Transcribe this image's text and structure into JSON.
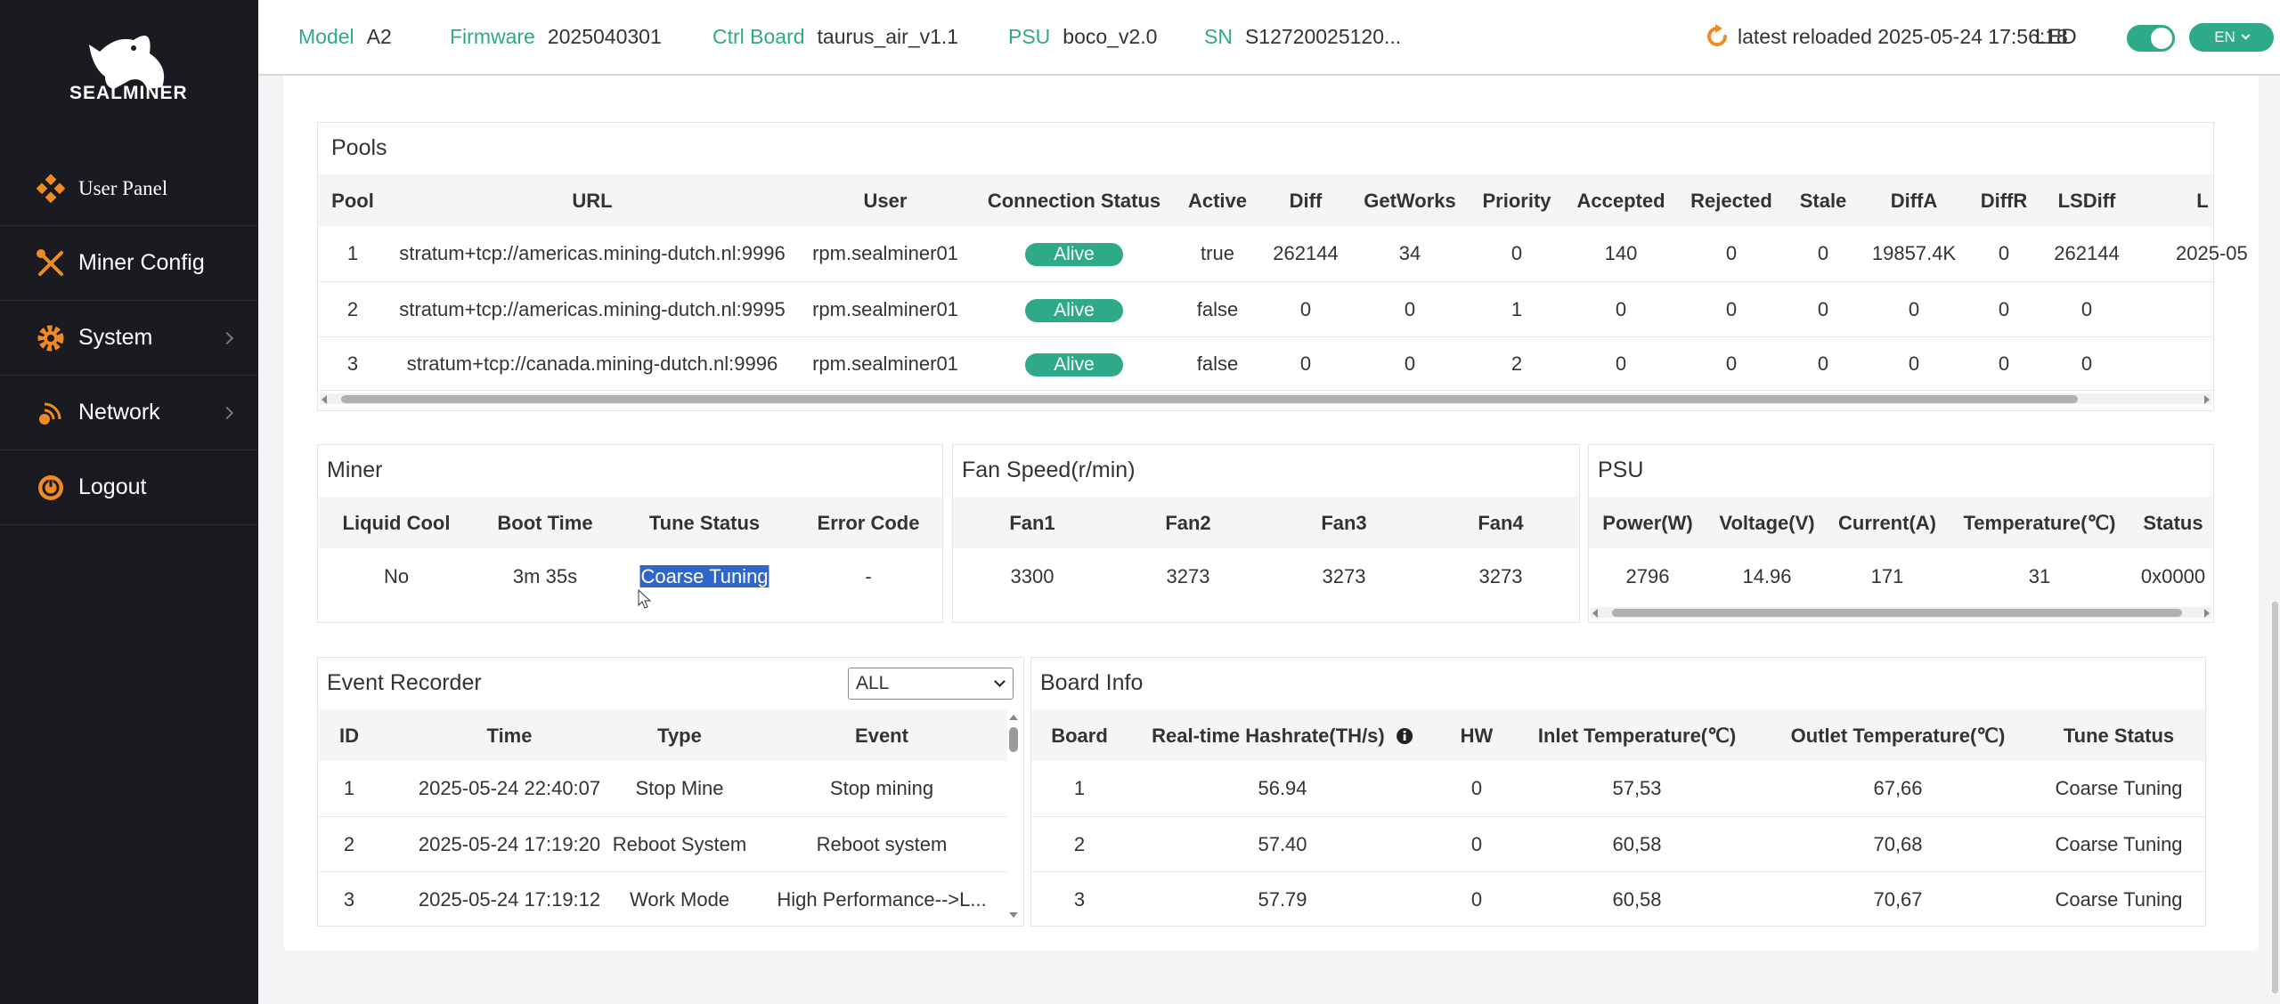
{
  "brand": {
    "name": "SEALMINER"
  },
  "sidebar": {
    "items": [
      {
        "label": "User Panel",
        "icon": "user-panel-icon"
      },
      {
        "label": "Miner Config",
        "icon": "tools-icon"
      },
      {
        "label": "System",
        "icon": "gear-icon"
      },
      {
        "label": "Network",
        "icon": "network-icon"
      },
      {
        "label": "Logout",
        "icon": "power-icon"
      }
    ]
  },
  "header": {
    "model_label": "Model",
    "model": "A2",
    "firmware_label": "Firmware",
    "firmware": "2025040301",
    "ctrl_label": "Ctrl Board",
    "ctrl": "taurus_air_v1.1",
    "psu_label": "PSU",
    "psu": "boco_v2.0",
    "sn_label": "SN",
    "sn": "S12720025120...",
    "reload": "latest reloaded 2025-05-24 17:56:18",
    "led_label": "LED",
    "lang": "EN",
    "accent": "#2eaa88"
  },
  "pools": {
    "title": "Pools",
    "columns": [
      "Pool",
      "URL",
      "User",
      "Connection Status",
      "Active",
      "Diff",
      "GetWorks",
      "Priority",
      "Accepted",
      "Rejected",
      "Stale",
      "DiffA",
      "DiffR",
      "LSDiff",
      "L"
    ],
    "rows": [
      [
        "1",
        "stratum+tcp://americas.mining-dutch.nl:9996",
        "rpm.sealminer01",
        "Alive",
        "true",
        "262144",
        "34",
        "0",
        "140",
        "0",
        "0",
        "19857.4K",
        "0",
        "262144",
        "2025-05"
      ],
      [
        "2",
        "stratum+tcp://americas.mining-dutch.nl:9995",
        "rpm.sealminer01",
        "Alive",
        "false",
        "0",
        "0",
        "1",
        "0",
        "0",
        "0",
        "0",
        "0",
        "0",
        ""
      ],
      [
        "3",
        "stratum+tcp://canada.mining-dutch.nl:9996",
        "rpm.sealminer01",
        "Alive",
        "false",
        "0",
        "0",
        "2",
        "0",
        "0",
        "0",
        "0",
        "0",
        "0",
        ""
      ]
    ]
  },
  "miner": {
    "title": "Miner",
    "columns": [
      "Liquid Cool",
      "Boot Time",
      "Tune Status",
      "Error Code"
    ],
    "row": [
      "No",
      "3m 35s",
      "Coarse Tuning",
      "-"
    ]
  },
  "fan": {
    "title": "Fan Speed(r/min)",
    "columns": [
      "Fan1",
      "Fan2",
      "Fan3",
      "Fan4"
    ],
    "row": [
      "3300",
      "3273",
      "3273",
      "3273"
    ]
  },
  "psu": {
    "title": "PSU",
    "columns": [
      "Power(W)",
      "Voltage(V)",
      "Current(A)",
      "Temperature(℃)",
      "Status"
    ],
    "row": [
      "2796",
      "14.96",
      "171",
      "31",
      "0x0000"
    ]
  },
  "events": {
    "title": "Event Recorder",
    "filter": "ALL",
    "columns": [
      "ID",
      "Time",
      "Type",
      "Event"
    ],
    "rows": [
      [
        "1",
        "2025-05-24 22:40:07",
        "Stop Mine",
        "Stop mining"
      ],
      [
        "2",
        "2025-05-24 17:19:20",
        "Reboot System",
        "Reboot system"
      ],
      [
        "3",
        "2025-05-24 17:19:12",
        "Work Mode",
        "High Performance-->L..."
      ]
    ]
  },
  "boards": {
    "title": "Board Info",
    "columns": [
      "Board",
      "Real-time Hashrate(TH/s)",
      "HW",
      "Inlet Temperature(℃)",
      "Outlet Temperature(℃)",
      "Tune Status"
    ],
    "rows": [
      [
        "1",
        "56.94",
        "0",
        "57,53",
        "67,66",
        "Coarse Tuning"
      ],
      [
        "2",
        "57.40",
        "0",
        "60,58",
        "70,68",
        "Coarse Tuning"
      ],
      [
        "3",
        "57.79",
        "0",
        "60,58",
        "70,67",
        "Coarse Tuning"
      ]
    ]
  }
}
